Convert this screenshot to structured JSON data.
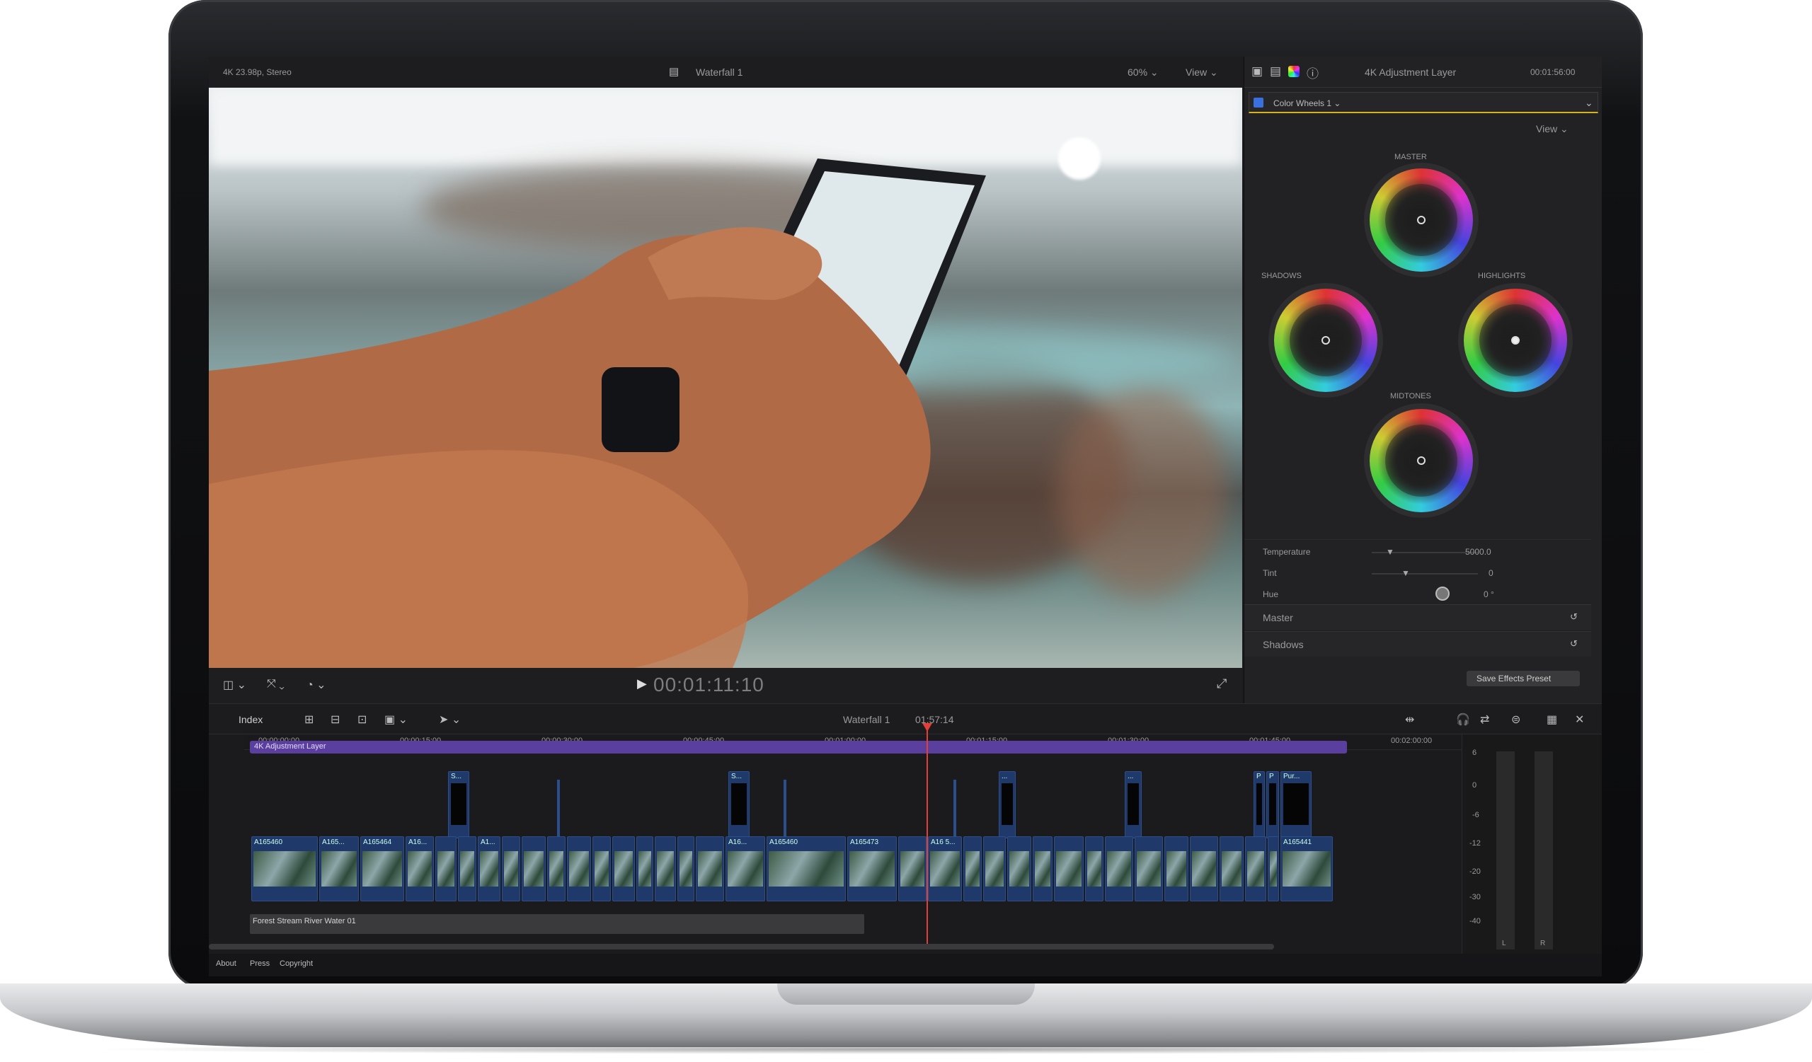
{
  "viewer": {
    "format": "4K 23.98p, Stereo",
    "project": "Waterfall 1",
    "zoom": "60%",
    "view_menu": "View",
    "timecode": "00:01:11:10"
  },
  "inspector": {
    "title": "4K Adjustment Layer",
    "duration": "00:01:56:00",
    "effect_name": "Color Wheels 1",
    "view_menu": "View",
    "wheels": {
      "master": "MASTER",
      "shadows": "SHADOWS",
      "highlights": "HIGHLIGHTS",
      "midtones": "MIDTONES"
    },
    "params": [
      {
        "label": "Temperature",
        "value": "5000.0"
      },
      {
        "label": "Tint",
        "value": "0"
      },
      {
        "label": "Hue",
        "value": "0 °"
      }
    ],
    "sections": [
      "Master",
      "Shadows"
    ],
    "save_preset": "Save Effects Preset"
  },
  "timeline": {
    "index_label": "Index",
    "project": "Waterfall 1",
    "duration": "01:57:14",
    "ruler": [
      "00:00:00:00",
      "00:00:15:00",
      "00:00:30:00",
      "00:00:45:00",
      "00:01:00:00",
      "00:01:15:00",
      "00:01:30:00",
      "00:01:45:00",
      "00:02:00:00"
    ],
    "adjustment_layer": "4K Adjustment Layer",
    "audio_clip": "Forest Stream River Water 01",
    "clip_labels": [
      "A165460",
      "A165...",
      "A165464",
      "A16...",
      "A1...",
      "A16...",
      "A165460",
      "A165473",
      "A16 5...",
      "A165441"
    ],
    "connected_labels": [
      "S...",
      "S...",
      "...",
      "...",
      "P",
      "P",
      "Pur..."
    ]
  },
  "meters": {
    "scale": [
      "6",
      "0",
      "-6",
      "-12",
      "-20",
      "-30",
      "-40"
    ],
    "channels": [
      "L",
      "R"
    ]
  },
  "footer": {
    "links": [
      "About",
      "Press",
      "Copyright"
    ]
  },
  "colors": {
    "adjustment_layer": "#5b3f9e",
    "clip_blue": "#1f3a6a",
    "playhead": "#e0403a",
    "accent_yellow": "#d8b31f"
  }
}
